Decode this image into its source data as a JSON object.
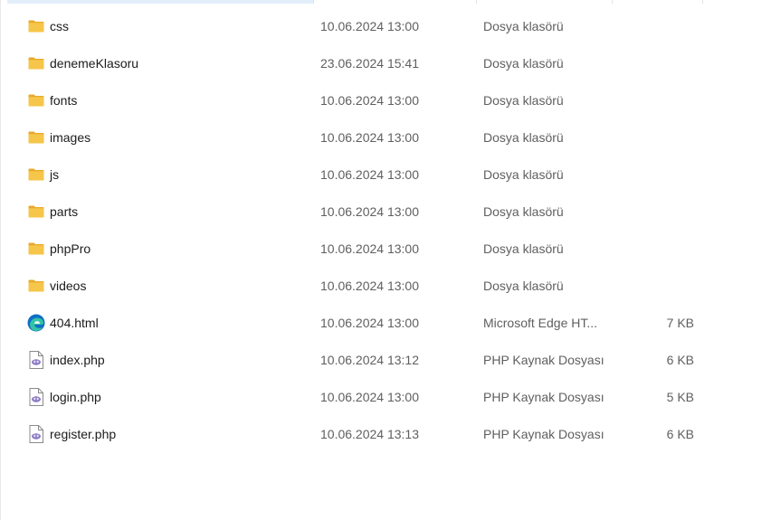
{
  "files": [
    {
      "name": "css",
      "date": "10.06.2024 13:00",
      "type": "Dosya klasörü",
      "size": "",
      "icon": "folder-icon"
    },
    {
      "name": "denemeKlasoru",
      "date": "23.06.2024 15:41",
      "type": "Dosya klasörü",
      "size": "",
      "icon": "folder-icon"
    },
    {
      "name": "fonts",
      "date": "10.06.2024 13:00",
      "type": "Dosya klasörü",
      "size": "",
      "icon": "folder-icon"
    },
    {
      "name": "images",
      "date": "10.06.2024 13:00",
      "type": "Dosya klasörü",
      "size": "",
      "icon": "folder-icon"
    },
    {
      "name": "js",
      "date": "10.06.2024 13:00",
      "type": "Dosya klasörü",
      "size": "",
      "icon": "folder-icon"
    },
    {
      "name": "parts",
      "date": "10.06.2024 13:00",
      "type": "Dosya klasörü",
      "size": "",
      "icon": "folder-icon"
    },
    {
      "name": "phpPro",
      "date": "10.06.2024 13:00",
      "type": "Dosya klasörü",
      "size": "",
      "icon": "folder-icon"
    },
    {
      "name": "videos",
      "date": "10.06.2024 13:00",
      "type": "Dosya klasörü",
      "size": "",
      "icon": "folder-icon"
    },
    {
      "name": "404.html",
      "date": "10.06.2024 13:00",
      "type": "Microsoft Edge HT...",
      "size": "7 KB",
      "icon": "edge-html-icon"
    },
    {
      "name": "index.php",
      "date": "10.06.2024 13:12",
      "type": "PHP Kaynak Dosyası",
      "size": "6 KB",
      "icon": "php-file-icon"
    },
    {
      "name": "login.php",
      "date": "10.06.2024 13:00",
      "type": "PHP Kaynak Dosyası",
      "size": "5 KB",
      "icon": "php-file-icon"
    },
    {
      "name": "register.php",
      "date": "10.06.2024 13:13",
      "type": "PHP Kaynak Dosyası",
      "size": "6 KB",
      "icon": "php-file-icon"
    }
  ],
  "colors": {
    "folder": "#f6c64a",
    "folder_dark": "#e8a92a",
    "edge_blue": "#0f6fc6",
    "edge_green": "#34c3a4",
    "php_purple": "#8c7ac5",
    "text_muted": "#5f5f5f"
  }
}
